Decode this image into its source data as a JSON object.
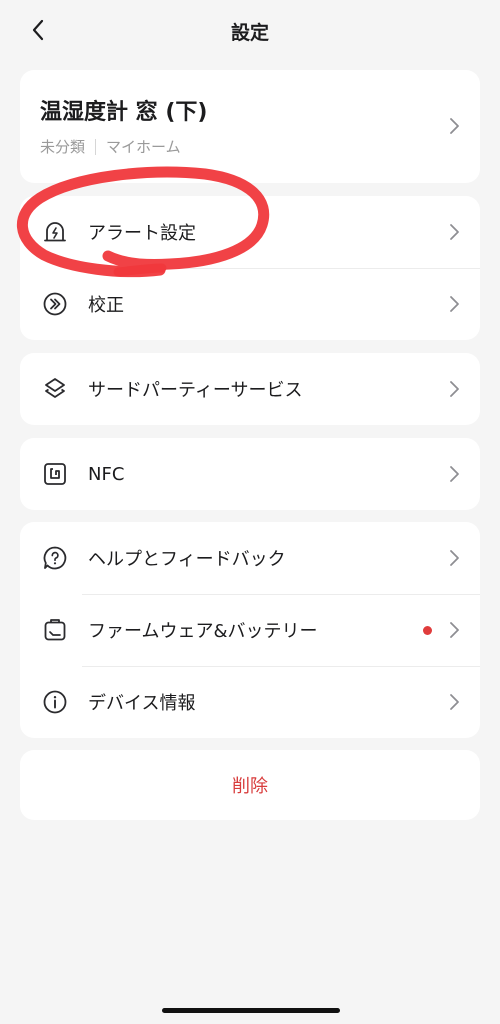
{
  "header": {
    "title": "設定"
  },
  "device": {
    "name": "温湿度計 窓 (下)",
    "category": "未分類",
    "home": "マイホーム"
  },
  "settings_group_1": [
    {
      "label": "アラート設定",
      "icon": "alert-bell-icon"
    },
    {
      "label": "校正",
      "icon": "calibration-icon"
    }
  ],
  "settings_group_2": [
    {
      "label": "サードパーティーサービス",
      "icon": "layers-icon"
    }
  ],
  "settings_group_3": [
    {
      "label": "NFC",
      "icon": "nfc-icon"
    }
  ],
  "settings_group_4": [
    {
      "label": "ヘルプとフィードバック",
      "icon": "help-chat-icon"
    },
    {
      "label": "ファームウェア&バッテリー",
      "icon": "firmware-icon",
      "has_update_dot": true
    },
    {
      "label": "デバイス情報",
      "icon": "info-icon"
    }
  ],
  "actions": {
    "delete_label": "削除"
  },
  "colors": {
    "accent_red": "#d83b3b",
    "annotation_red": "#f0383c",
    "background": "#f5f5f5"
  }
}
